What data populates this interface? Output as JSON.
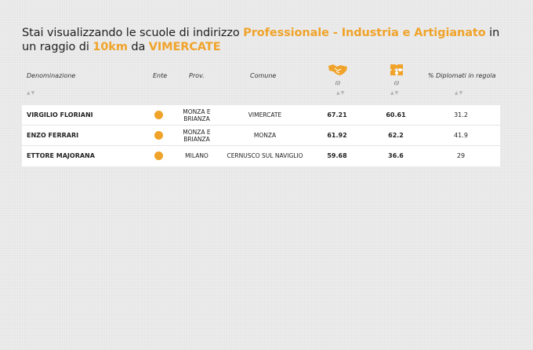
{
  "headline": {
    "prefix": "Stai visualizzando le scuole di indirizzo ",
    "indirizzo": "Professionale - Industria e Artigianato",
    "middle": " in un raggio di ",
    "raggio": "10km",
    "da": " da ",
    "citta": "VIMERCATE"
  },
  "columns": {
    "denominazione": "Denominazione",
    "ente": "Ente",
    "prov": "Prov.",
    "comune": "Comune",
    "info1": "(i)",
    "info2": "(i)",
    "diplomati": "% Diplomati in regola"
  },
  "sort_glyph": "▲▼",
  "accent_color": "#f0a32a",
  "icons": [
    "handshake-icon",
    "puzzle-icon"
  ],
  "rows": [
    {
      "name": "VIRGILIO FLORIANI",
      "prov_line1": "MONZA E",
      "prov_line2": "BRIANZA",
      "comune": "VIMERCATE",
      "v1": "67.21",
      "v2": "60.61",
      "v3": "31.2"
    },
    {
      "name": "ENZO FERRARI",
      "prov_line1": "MONZA E",
      "prov_line2": "BRIANZA",
      "comune": "MONZA",
      "v1": "61.92",
      "v2": "62.2",
      "v3": "41.9"
    },
    {
      "name": "ETTORE MAJORANA",
      "prov_line1": "MILANO",
      "prov_line2": "",
      "comune": "CERNUSCO SUL NAVIGLIO",
      "v1": "59.68",
      "v2": "36.6",
      "v3": "29"
    }
  ]
}
